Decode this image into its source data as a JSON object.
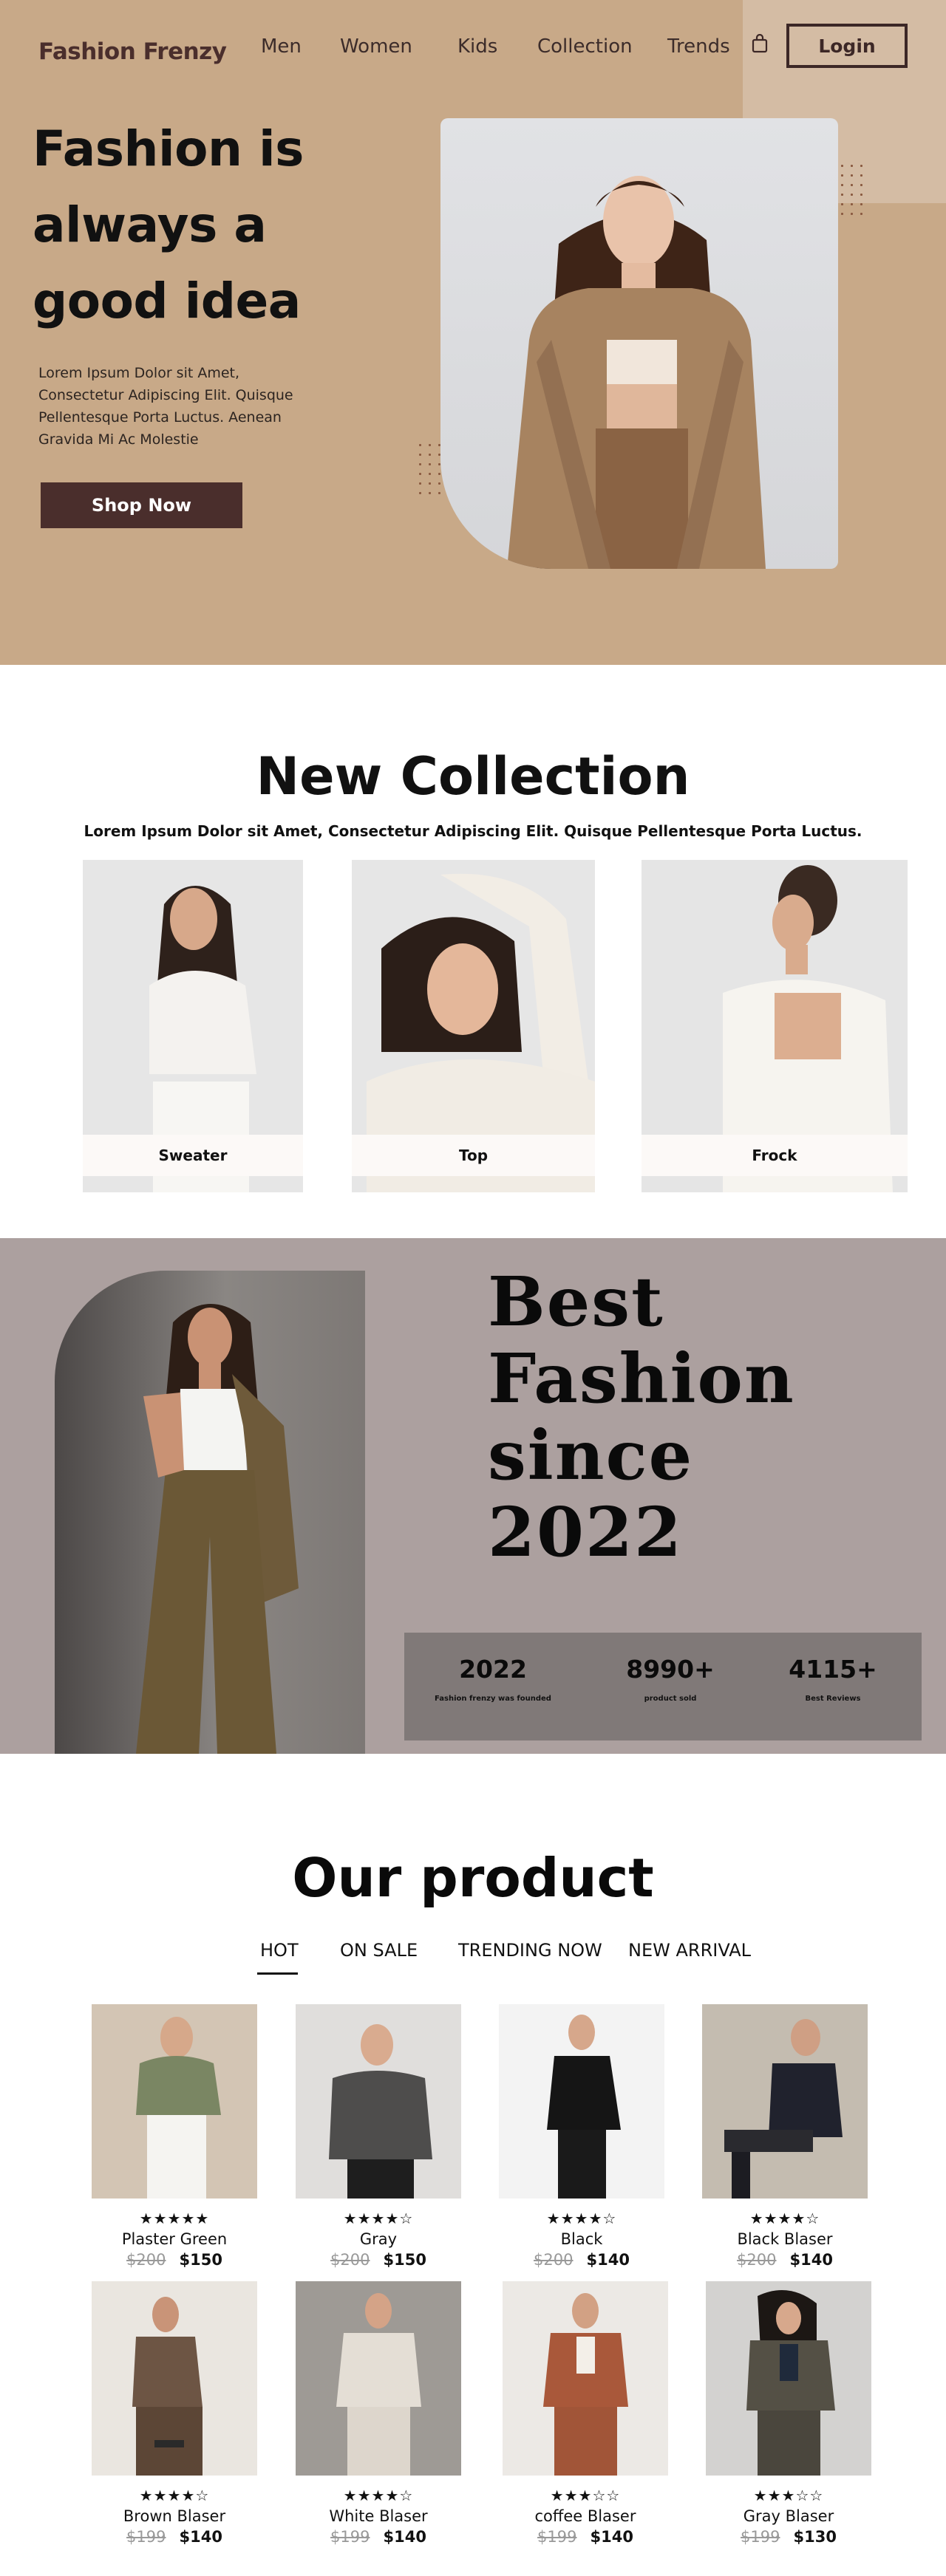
{
  "header": {
    "brand": "Fashion Frenzy",
    "nav": [
      "Men",
      "Women",
      "Kids",
      "Collection",
      "Trends"
    ],
    "login": "Login"
  },
  "hero": {
    "title": "Fashion is always a good idea",
    "text": "Lorem Ipsum Dolor sit Amet, Consectetur Adipiscing Elit. Quisque Pellentesque Porta Luctus. Aenean Gravida Mi Ac Molestie",
    "cta": "Shop Now"
  },
  "new_collection": {
    "title": "New Collection",
    "subtitle": "Lorem Ipsum Dolor sit Amet, Consectetur Adipiscing Elit. Quisque  Pellentesque Porta Luctus.",
    "cards": [
      "Sweater",
      "Top",
      "Frock"
    ]
  },
  "best": {
    "title": "Best Fashion since 2022",
    "stats": [
      {
        "value": "2022",
        "label": "Fashion frenzy was founded"
      },
      {
        "value": "8990+",
        "label": "product sold"
      },
      {
        "value": "4115+",
        "label": "Best Reviews"
      }
    ]
  },
  "products": {
    "title": "Our product",
    "tabs": [
      "HOT",
      "ON SALE",
      "TRENDING NOW",
      "NEW ARRIVAL"
    ],
    "active_tab": "HOT",
    "items": [
      {
        "name": "Plaster Green",
        "stars": "★★★★★",
        "old": "$200",
        "price": "$150"
      },
      {
        "name": "Gray",
        "stars": "★★★★☆",
        "old": "$200",
        "price": "$150"
      },
      {
        "name": "Black",
        "stars": "★★★★☆",
        "old": "$200",
        "price": "$140"
      },
      {
        "name": "Black Blaser",
        "stars": "★★★★☆",
        "old": "$200",
        "price": "$140"
      },
      {
        "name": "Brown Blaser",
        "stars": "★★★★☆",
        "old": "$199",
        "price": "$140"
      },
      {
        "name": "White Blaser",
        "stars": "★★★★☆",
        "old": "$199",
        "price": "$140"
      },
      {
        "name": "coffee Blaser",
        "stars": "★★★☆☆",
        "old": "$199",
        "price": "$140"
      },
      {
        "name": "Gray Blaser",
        "stars": "★★★☆☆",
        "old": "$199",
        "price": "$130"
      }
    ]
  },
  "colors": {
    "hero_bg": "#c8a988",
    "accent": "#4a2e2c",
    "best_bg": "#aca09f",
    "stats_bg": "#807978"
  }
}
